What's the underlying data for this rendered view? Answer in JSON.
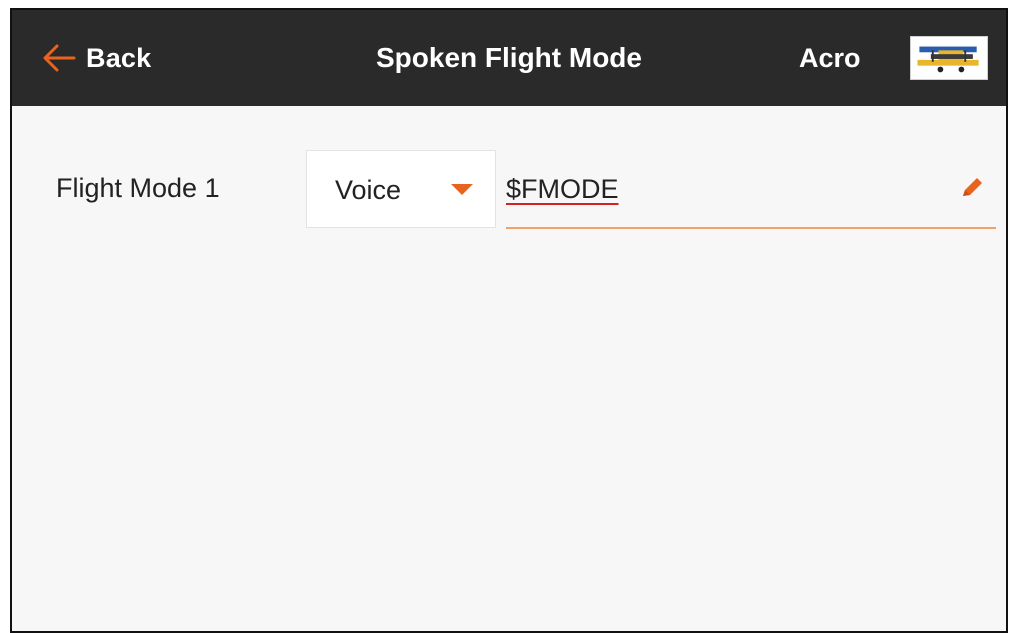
{
  "header": {
    "back_label": "Back",
    "title": "Spoken Flight Mode",
    "model_name": "Acro",
    "background": "#2a2a2a",
    "accent": "#e8641e"
  },
  "content": {
    "row_label": "Flight Mode 1",
    "select": {
      "value": "Voice",
      "caret_icon": "triangle-down-icon"
    },
    "text_field": {
      "value": "$FMODE",
      "edit_icon": "pencil-icon"
    }
  }
}
